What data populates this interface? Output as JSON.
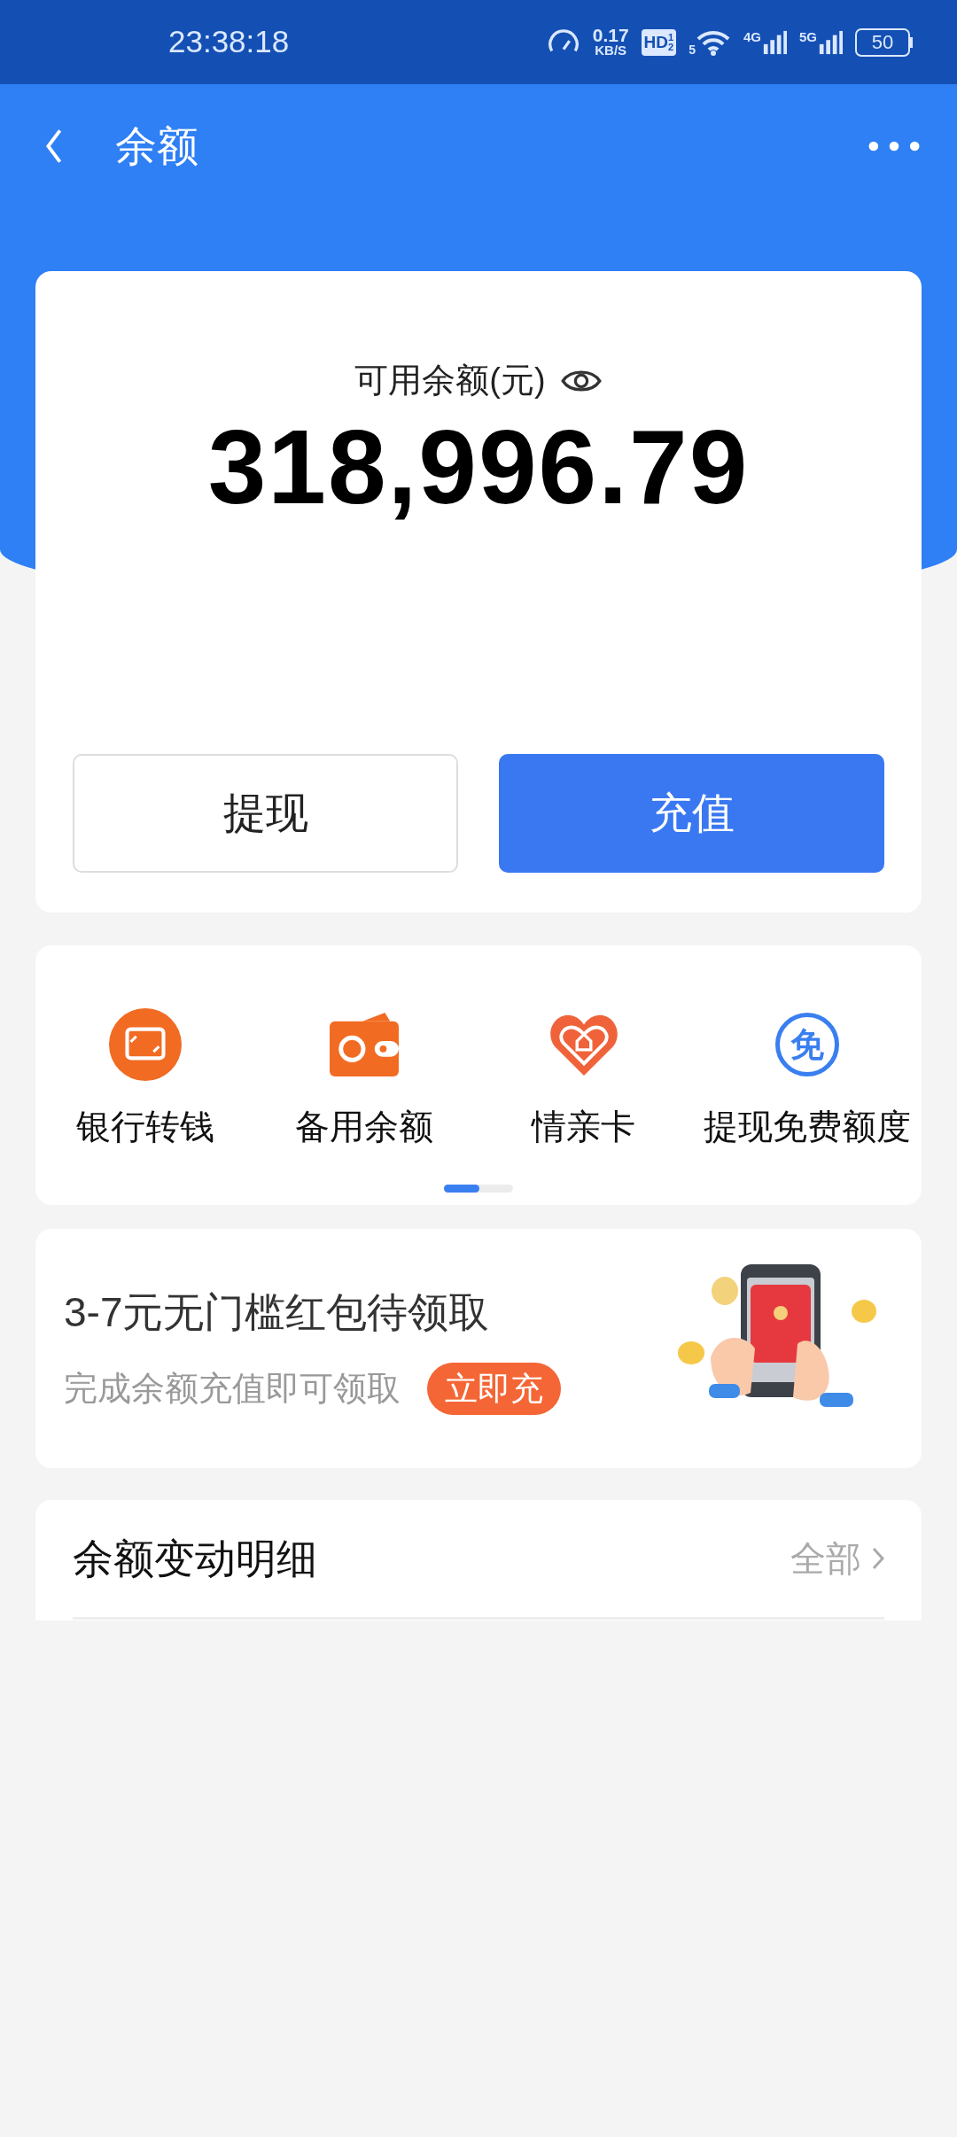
{
  "status_bar": {
    "time": "23:38:18",
    "speed_value": "0.17",
    "speed_unit": "KB/S",
    "hd": "HD",
    "hd_sub": "1",
    "hd_sub2": "2",
    "wifi_label": "5",
    "networks": [
      "4G",
      "5G"
    ],
    "battery": "50"
  },
  "header": {
    "title": "余额"
  },
  "balance": {
    "label": "可用余额(元)",
    "amount": "318,996.79"
  },
  "buttons": [
    {
      "label": "提现",
      "kind": "outline"
    },
    {
      "label": "充值",
      "kind": "primary"
    }
  ],
  "shortcuts": [
    {
      "label": "银行转钱",
      "kind": "transfer"
    },
    {
      "label": "备用余额",
      "kind": "wallet"
    },
    {
      "label": "情亲卡",
      "kind": "heart"
    },
    {
      "label": "提现免费额度",
      "kind": "free",
      "icon_text": "免"
    }
  ],
  "promo": {
    "title": "3-7元无门槛红包待领取",
    "subtitle": "完成余额充值即可领取",
    "badge": "立即充"
  },
  "details": {
    "title": "余额变动明细",
    "link": "全部"
  }
}
